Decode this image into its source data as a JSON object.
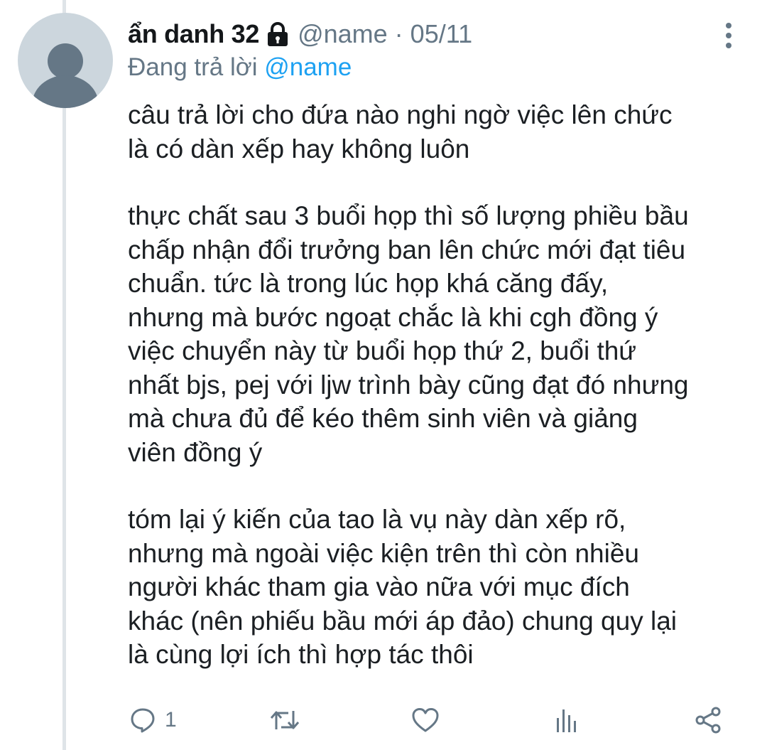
{
  "tweet": {
    "display_name": "ẩn danh 32",
    "handle": "@name",
    "separator": "·",
    "date": "05/11",
    "reply_prefix": "Đang trả lời",
    "reply_to": "@name",
    "paragraphs": [
      [
        "câu trả lời cho đứa nào nghi ngờ việc lên chức",
        "là có dàn xếp hay không luôn"
      ],
      [
        "thực chất sau 3 buổi họp thì số lượng phiều bầu",
        "chấp nhận đổi trưởng ban lên chức mới đạt tiêu",
        "chuẩn. tức là trong lúc họp khá căng đấy,",
        "nhưng mà bước ngoạt chắc là khi cgh đồng ý",
        "việc chuyển này từ buổi họp thứ 2, buổi thứ",
        "nhất bjs, pej với ljw trình bày cũng đạt đó nhưng",
        "mà chưa đủ để kéo thêm sinh viên và giảng",
        "viên đồng ý"
      ],
      [
        "tóm lại ý kiến của tao là vụ này dàn xếp rõ,",
        "nhưng mà ngoài việc kiện trên thì còn nhiều",
        "người khác tham gia vào nữa với mục đích",
        "khác (nên phiếu bầu mới áp đảo) chung quy lại",
        "là cùng lợi ích thì hợp tác thôi"
      ]
    ]
  },
  "actions": {
    "reply_icon": "comment-bubble-icon",
    "reply_count": "1",
    "retweet_icon": "retweet-icon",
    "like_icon": "heart-icon",
    "stats_icon": "bar-chart-icon",
    "share_icon": "share-icon"
  },
  "icons": {
    "avatar": "default-person-avatar",
    "protected": "lock-icon",
    "menu": "vertical-dots-icon"
  },
  "colors": {
    "text_primary": "#14171a",
    "text_secondary": "#657786",
    "mention": "#1da1f2",
    "avatar_bg": "#ccd6dd",
    "avatar_fg": "#657786",
    "thread_line": "#dfe4e8"
  }
}
